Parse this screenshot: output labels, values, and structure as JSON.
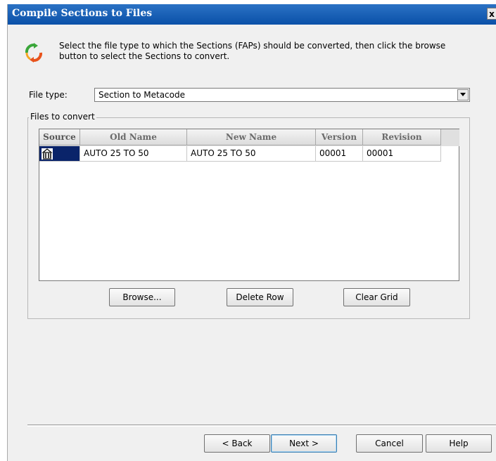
{
  "window": {
    "title": "Compile Sections to Files",
    "close_glyph": "x"
  },
  "header": {
    "icon": "refresh-arrows-icon",
    "instructions": "Select the file type to which the Sections (FAPs) should be converted, then click the browse button to select the Sections to convert."
  },
  "file_type": {
    "label": "File type:",
    "selected": "Section to Metacode"
  },
  "files_group": {
    "legend": "Files to convert",
    "columns": [
      "Source",
      "Old Name",
      "New Name",
      "Version",
      "Revision"
    ],
    "rows": [
      {
        "source_icon": "library-icon",
        "old_name": "AUTO 25 TO 50",
        "new_name": "AUTO 25 TO 50",
        "version": "00001",
        "revision": "00001"
      }
    ],
    "buttons": {
      "browse": "Browse...",
      "delete_row": "Delete Row",
      "clear_grid": "Clear Grid"
    }
  },
  "footer": {
    "back": "< Back",
    "next": "Next >",
    "cancel": "Cancel",
    "help": "Help"
  },
  "colors": {
    "titlebar": "#0a50a8",
    "selection": "#0a246a",
    "dialog_bg": "#f0f0f0"
  }
}
